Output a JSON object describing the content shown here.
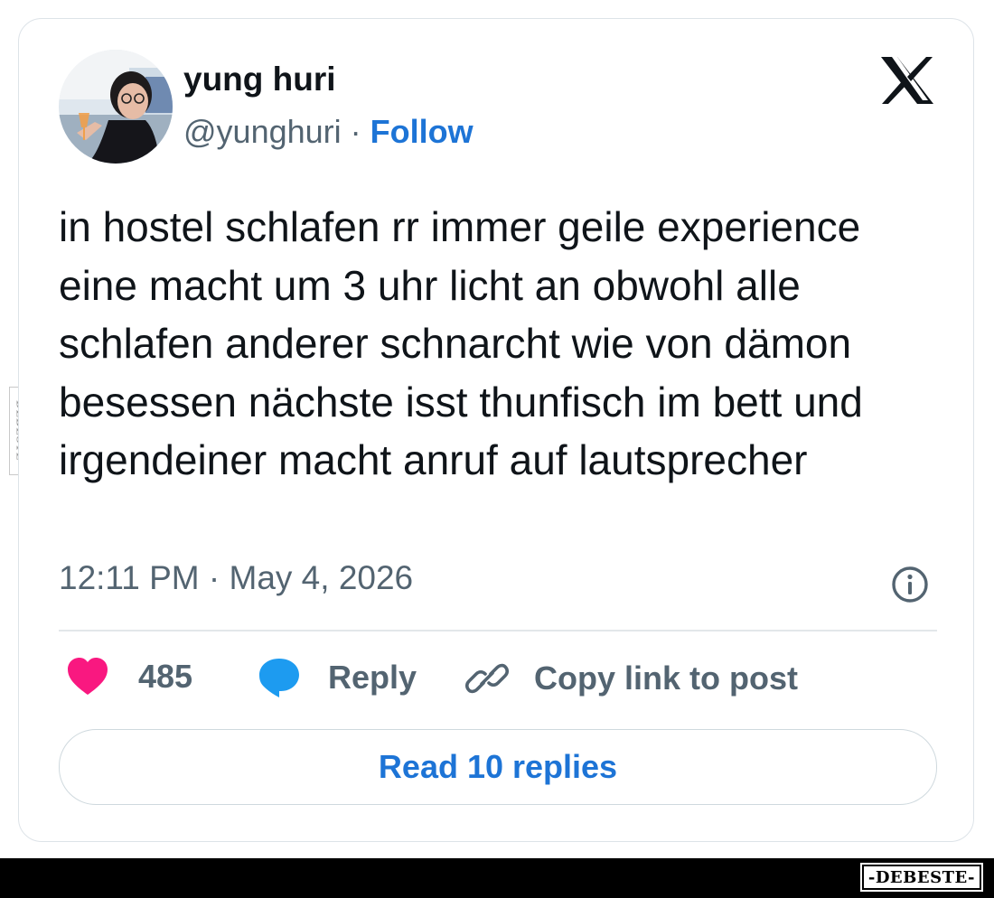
{
  "tweet": {
    "author_name": "yung huri",
    "handle": "@yunghuri",
    "separator": "·",
    "follow_label": "Follow",
    "text": "in hostel schlafen rr immer geile experience eine macht um 3 uhr licht an obwohl alle schlafen anderer schnarcht wie von dämon besessen nächste isst thunfisch im bett und irgendeiner macht anruf auf lautsprecher",
    "timestamp": "12:11 PM · May 4, 2026"
  },
  "actions": {
    "like_count": "485",
    "reply_label": "Reply",
    "copy_link_label": "Copy link to post"
  },
  "read_replies_label": "Read 10 replies",
  "watermark": {
    "side_text": "DEBESTE",
    "bottom_text": "-DEBESTE-"
  },
  "icons": {
    "logo": "x-logo-icon",
    "info": "info-icon",
    "like": "heart-icon",
    "reply": "speech-bubble-icon",
    "copy": "link-icon"
  },
  "colors": {
    "like": "#f91880",
    "reply": "#1d9bf0",
    "link": "#1d74d6",
    "secondary_text": "#536471",
    "primary_text": "#0f1419"
  }
}
